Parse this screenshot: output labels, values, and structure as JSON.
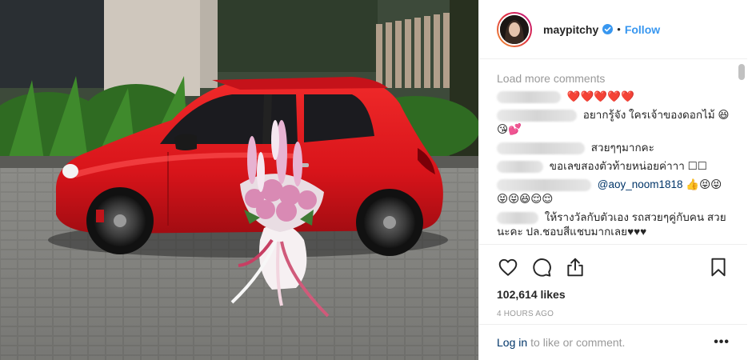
{
  "colors": {
    "accent": "#3897f0",
    "link": "#003569",
    "muted": "#999999",
    "heart_red": "#ed4956"
  },
  "header": {
    "username": "maypitchy",
    "separator": "•",
    "follow_label": "Follow",
    "verified_icon": "verified-badge-icon"
  },
  "comments": {
    "load_more": "Load more comments",
    "items": [
      {
        "text": "❤️❤️❤️❤️❤️"
      },
      {
        "text": "อยากรู้จัง ใครเจ้าของดอกไม้ 😆😘💕"
      },
      {
        "text": "สวยๆๆมากคะ"
      },
      {
        "text": "ขอเลขสองตัวท้ายหน่อยค่าาา ☐☐"
      },
      {
        "mention": "@aoy_noom1818",
        "text": " 👍😝😝😝😝😆😌😌"
      },
      {
        "text": "ให้รางวัลกับตัวเอง รถสวยๆคู่กับคน สวยนะคะ ปล.ชอบสีแชบมากเลย♥♥♥"
      }
    ]
  },
  "post": {
    "likes": "102,614 likes",
    "time": "4 HOURS AGO"
  },
  "footer": {
    "login_link": "Log in",
    "login_text": "to like or comment.",
    "more_label": "•••"
  }
}
